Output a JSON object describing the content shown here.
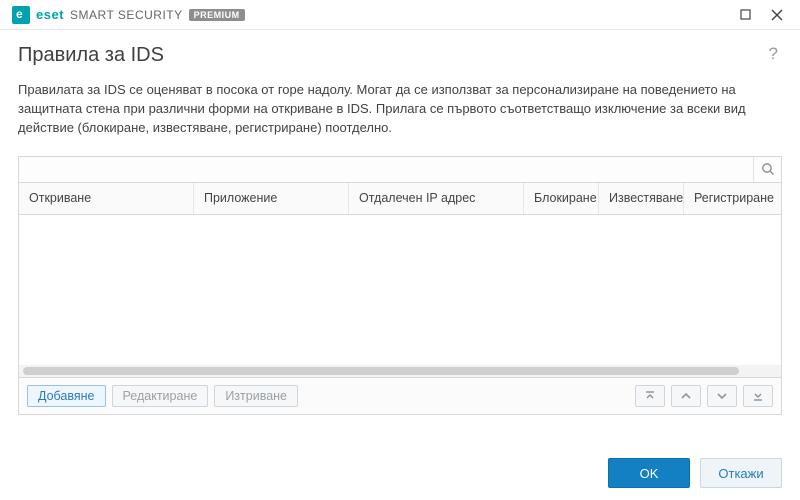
{
  "brand": {
    "eset": "eset",
    "name": "SMART SECURITY",
    "badge": "PREMIUM"
  },
  "page": {
    "title": "Правила за IDS",
    "description": "Правилата за IDS се оценяват в посока от горе надолу. Могат да се използват за персонализиране на поведението на защитната стена при различни форми на откриване в IDS. Прилага се първото съответстващо изключение за всеки вид действие (блокиране, известяване, регистриране) поотделно."
  },
  "search": {
    "placeholder": ""
  },
  "columns": {
    "c0": "Откриване",
    "c1": "Приложение",
    "c2": "Отдалечен IP адрес",
    "c3": "Блокиране",
    "c4": "Известяване",
    "c5": "Регистриране"
  },
  "actions": {
    "add": "Добавяне",
    "edit": "Редактиране",
    "delete": "Изтриване"
  },
  "footer": {
    "ok": "OK",
    "cancel": "Откажи"
  }
}
